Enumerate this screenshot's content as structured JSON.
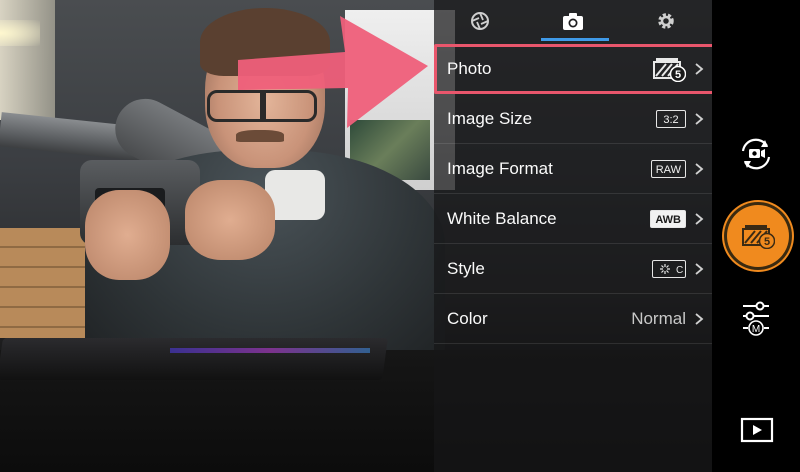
{
  "tabs": [
    {
      "id": "aperture",
      "icon": "aperture-icon",
      "active": false
    },
    {
      "id": "camera",
      "icon": "camera-icon",
      "active": true
    },
    {
      "id": "settings",
      "icon": "gear-icon",
      "active": false
    }
  ],
  "menu": [
    {
      "label": "Photo",
      "value_type": "icon",
      "value_icon": "burst-mode-icon",
      "burst_count": "5",
      "highlighted": true
    },
    {
      "label": "Image Size",
      "value_type": "badge",
      "value": "3:2"
    },
    {
      "label": "Image Format",
      "value_type": "badge",
      "value": "RAW"
    },
    {
      "label": "White Balance",
      "value_type": "badge-filled",
      "value": "AWB"
    },
    {
      "label": "Style",
      "value_type": "icon",
      "value_icon": "style-icon",
      "style_letter": "C"
    },
    {
      "label": "Color",
      "value_type": "text",
      "value": "Normal"
    }
  ],
  "rail": {
    "switch_mode_icon": "camera-switch-icon",
    "shutter_icon": "burst-mode-icon",
    "shutter_count": "5",
    "manual_settings_icon": "manual-sliders-icon",
    "manual_badge": "M",
    "playback_icon": "playback-icon"
  },
  "colors": {
    "accent_tab": "#3f9ae8",
    "highlight_border": "#e9566c",
    "annotation_arrow": "#ef5f7a",
    "shutter": "#f08a1e"
  }
}
